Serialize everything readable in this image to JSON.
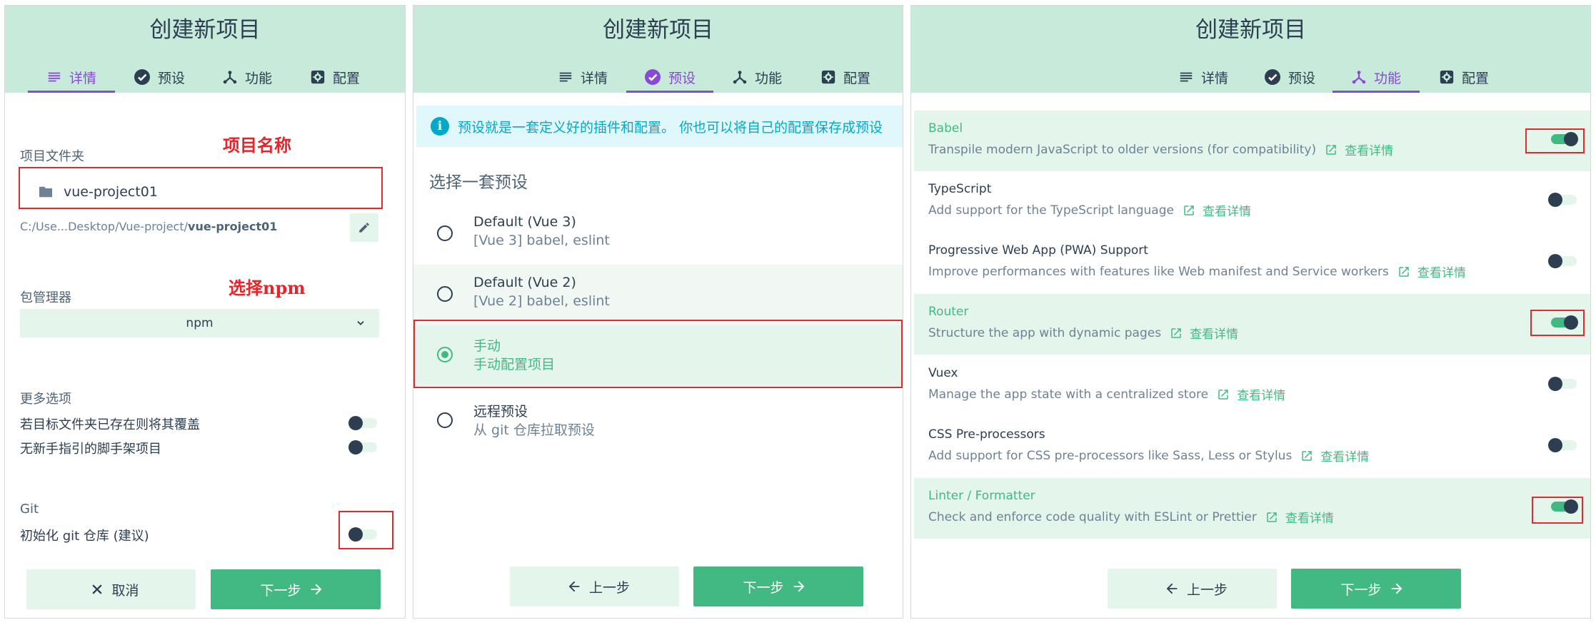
{
  "colors": {
    "header_bg": "#c7eadb",
    "accent_green": "#42b983",
    "active_tab": "#8a48d8",
    "annotation_red": "#e6252b",
    "info_cyan": "#03a9c7"
  },
  "panel1": {
    "title": "创建新项目",
    "tabs": [
      {
        "label": "详情",
        "icon": "list-icon",
        "active": true
      },
      {
        "label": "预设",
        "icon": "check-circle-icon",
        "active": false
      },
      {
        "label": "功能",
        "icon": "fork-icon",
        "active": false
      },
      {
        "label": "配置",
        "icon": "settings-icon",
        "active": false
      }
    ],
    "folder_label": "项目文件夹",
    "annotation_name": "项目名称",
    "folder_value": "vue-project01",
    "path_prefix": "C:/Use...Desktop/Vue-project/",
    "path_bold": "vue-project01",
    "pm_label": "包管理器",
    "annotation_npm": "选择npm",
    "pm_value": "npm",
    "more_label": "更多选项",
    "options": [
      {
        "label": "若目标文件夹已存在则将其覆盖",
        "on": false
      },
      {
        "label": "无新手指引的脚手架项目",
        "on": false
      }
    ],
    "git_label": "Git",
    "git_option": "初始化 git 仓库 (建议)",
    "cancel": "取消",
    "next": "下一步"
  },
  "panel2": {
    "title": "创建新项目",
    "tabs": [
      {
        "label": "详情",
        "icon": "list-icon",
        "active": false
      },
      {
        "label": "预设",
        "icon": "check-circle-icon",
        "active": true
      },
      {
        "label": "功能",
        "icon": "fork-icon",
        "active": false
      },
      {
        "label": "配置",
        "icon": "settings-icon",
        "active": false
      }
    ],
    "info": "预设就是一套定义好的插件和配置。 你也可以将自己的配置保存成预设",
    "section_title": "选择一套预设",
    "presets": [
      {
        "name": "Default (Vue 3)",
        "desc": "[Vue 3] babel, eslint",
        "selected": false
      },
      {
        "name": "Default (Vue 2)",
        "desc": "[Vue 2] babel, eslint",
        "selected": false
      },
      {
        "name": "手动",
        "desc": "手动配置项目",
        "selected": true
      },
      {
        "name": "远程预设",
        "desc": "从 git 仓库拉取预设",
        "selected": false
      }
    ],
    "prev": "上一步",
    "next": "下一步"
  },
  "panel3": {
    "title": "创建新项目",
    "tabs": [
      {
        "label": "详情",
        "icon": "list-icon",
        "active": false
      },
      {
        "label": "预设",
        "icon": "check-circle-icon",
        "active": false
      },
      {
        "label": "功能",
        "icon": "fork-icon",
        "active": true
      },
      {
        "label": "配置",
        "icon": "settings-icon",
        "active": false
      }
    ],
    "features": [
      {
        "name": "Babel",
        "desc": "Transpile modern JavaScript to older versions (for compatibility)",
        "link": "查看详情",
        "on": true
      },
      {
        "name": "TypeScript",
        "desc": "Add support for the TypeScript language",
        "link": "查看详情",
        "on": false
      },
      {
        "name": "Progressive Web App (PWA) Support",
        "desc": "Improve performances with features like Web manifest and Service workers",
        "link": "查看详情",
        "on": false
      },
      {
        "name": "Router",
        "desc": "Structure the app with dynamic pages",
        "link": "查看详情",
        "on": true
      },
      {
        "name": "Vuex",
        "desc": "Manage the app state with a centralized store",
        "link": "查看详情",
        "on": false
      },
      {
        "name": "CSS Pre-processors",
        "desc": "Add support for CSS pre-processors like Sass, Less or Stylus",
        "link": "查看详情",
        "on": false
      },
      {
        "name": "Linter / Formatter",
        "desc": "Check and enforce code quality with ESLint or Prettier",
        "link": "查看详情",
        "on": true
      }
    ],
    "prev": "上一步",
    "next": "下一步"
  }
}
